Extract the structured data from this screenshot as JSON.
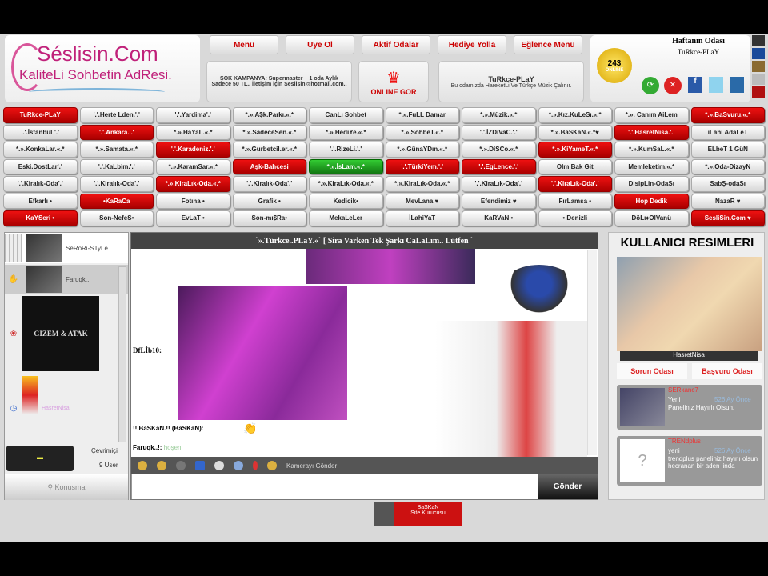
{
  "logo": {
    "title": "Séslisin.Com",
    "subtitle": "KaliteLi Sohbetin AdResi."
  },
  "nav": [
    "Menü",
    "Uye Ol",
    "Aktif Odalar",
    "Hediye Yolla",
    "Eğlence Menü"
  ],
  "promo": "ŞOK KAMPANYA: Supermaster + 1 oda Aylık Sadece 50 TL.. İletişim için Seslisin@hotmail.com..",
  "online_label": "ONLINE GOR",
  "room_info": {
    "name": "TuRkce-PLaY",
    "desc": "Bu odamızda HareketLi Ve Türkçe Müzik Çalınır."
  },
  "week_room": {
    "title": "Haftanın Odası",
    "name": "TuRkce-PLaY",
    "badge": "243",
    "badge_sub": "ONLINE"
  },
  "theme_colors": [
    "#333333",
    "#1a4a9a",
    "#8a6a30",
    "#bbbbbb",
    "#b01010"
  ],
  "grid": [
    [
      [
        "TuRkce-PLaY",
        "red"
      ],
      [
        "'.'.Herte Lden.'.'",
        ""
      ],
      [
        "'.'.Yardima'.'",
        ""
      ],
      [
        "*.».A$k.Parkı.«.*",
        ""
      ],
      [
        "CanLı Sohbet",
        ""
      ],
      [
        "*.».FuLL Damar",
        ""
      ],
      [
        "*.».Müzik.«.*",
        ""
      ],
      [
        "*.».Kız.KuLeSı.«.*",
        ""
      ],
      [
        "*.». Canım AiLem",
        ""
      ],
      [
        "*.».BaSvuru.«.*",
        "red"
      ]
    ],
    [
      [
        "'.'.İstanbuL'.'",
        ""
      ],
      [
        "'.'.Ankara.'.'",
        "red"
      ],
      [
        "*.».HaYaL.«.*",
        ""
      ],
      [
        "*.».SadeceSen.«.*",
        ""
      ],
      [
        "*.».HediYe.«.*",
        ""
      ],
      [
        "*.».SohbeT.«.*",
        ""
      ],
      [
        "'.'.İZDiVaC.'.'",
        ""
      ],
      [
        "*.».BaSKaN.«.*♥",
        ""
      ],
      [
        "'.'.HasretNisa.'.'",
        "red"
      ],
      [
        "iLahi AdaLeT",
        ""
      ]
    ],
    [
      [
        "*.».KonkaLar.«.*",
        ""
      ],
      [
        "*.».Samata.«.*",
        ""
      ],
      [
        "'.'.Karadeniz.'.'",
        "red"
      ],
      [
        "*.».Gurbetcil.er.«.*",
        ""
      ],
      [
        "'.'.RizeLi.'.'",
        ""
      ],
      [
        "*.».GünaYDın.«.*",
        ""
      ],
      [
        "*.».DiSCo.«.*",
        ""
      ],
      [
        "*.».KiYameT.«.*",
        "red"
      ],
      [
        "*.».KumSaL.«.*",
        ""
      ],
      [
        "ELbeT 1 GüN",
        ""
      ]
    ],
    [
      [
        "Eski.DostLar'.'",
        ""
      ],
      [
        "'.'.KaLbim.'.'",
        ""
      ],
      [
        "*.».KaramSar.«.*",
        ""
      ],
      [
        "Aşk-Bahcesi",
        "red"
      ],
      [
        "*.».İsLam.«.*",
        "green"
      ],
      [
        "'.'.TürkiYem.'.'",
        "red"
      ],
      [
        "'.'.EgLence.'.'",
        "red"
      ],
      [
        "Olm Bak Git",
        ""
      ],
      [
        "Memleketim.«.*",
        ""
      ],
      [
        "*.».Oda-DizayN",
        ""
      ]
    ],
    [
      [
        "'.'.Kiralık-Oda'.'",
        ""
      ],
      [
        "'.'.Kiralık-Oda'.'",
        ""
      ],
      [
        "*.».KiraLık-Oda.«.*",
        "red"
      ],
      [
        "'.'.Kiralık-Oda'.'",
        ""
      ],
      [
        "*.».KiraLık-Oda.«.*",
        ""
      ],
      [
        "*.».KiraLık-Oda.«.*",
        ""
      ],
      [
        "'.'.KiraLık-Oda'.'",
        ""
      ],
      [
        "'.'.KiraLık-Oda'.'",
        "red"
      ],
      [
        "DisipLin-OdaSı",
        ""
      ],
      [
        "SabŞ-odaSı",
        ""
      ]
    ],
    [
      [
        "Efkarlı •",
        ""
      ],
      [
        "•KaRaCa",
        "red"
      ],
      [
        "Fotına •",
        ""
      ],
      [
        "Grafik •",
        ""
      ],
      [
        "Kedicik•",
        ""
      ],
      [
        "MevLana ♥",
        ""
      ],
      [
        "Efendimiz ♥",
        ""
      ],
      [
        "FırLamsa •",
        ""
      ],
      [
        "Hop Dedik",
        "red"
      ],
      [
        "NazaR ♥",
        ""
      ]
    ],
    [
      [
        "KaYSeri •",
        "red"
      ],
      [
        "Son-NefeS•",
        ""
      ],
      [
        "EvLaT •",
        ""
      ],
      [
        "Son-mı$Ra•",
        ""
      ],
      [
        "MekaLeLer",
        ""
      ],
      [
        "İLahiYaT",
        ""
      ],
      [
        "KaRVaN •",
        ""
      ],
      [
        "• Denizli",
        ""
      ],
      [
        "DöLı♦OlVanü",
        ""
      ],
      [
        "SesliSin.Com ♥",
        "red"
      ]
    ]
  ],
  "users": [
    {
      "name": "SeRoRi-STyLe"
    },
    {
      "name": "Faruqk..!"
    },
    {
      "name": "GIZEM & ATAK"
    },
    {
      "name": "HasretNisa"
    }
  ],
  "user_footer": {
    "link": "Çevrimiçi",
    "count": "9 User",
    "tab": "Konusma"
  },
  "chat": {
    "title": "`».Türkce..PLaY.«` [ Sira Varken Tek Şarkı CaLaLım.. Lütfen `",
    "messages": [
      {
        "nick": "DfLİb10:",
        "text": ""
      },
      {
        "nick": "!!.BaSKaN.!! (BaSKaN):",
        "text": ""
      },
      {
        "nick": "Faruqk..!:",
        "text": "hoşen"
      }
    ],
    "camera_label": "Kamerayı Gönder",
    "input_placeholder": "",
    "send": "Gönder"
  },
  "banner": {
    "line1": "BaSKaN",
    "line2": "Site Kurucusu"
  },
  "right": {
    "title": "KULLANICI RESIMLERI",
    "photo_name": "HasretNisa",
    "buttons": [
      "Sorun Odası",
      "Başvuru Odası"
    ],
    "posts": [
      {
        "user": "SERkanc7",
        "type": "Yeni",
        "time": "526 Ay Önce",
        "text": "Paneliniz Hayırlı Olsun."
      },
      {
        "user": "TRENdplus",
        "type": "yeni",
        "time": "526 Ay Önce",
        "text": "trendplus paneliniz hayırlı olsun hecranan bir aden linda"
      }
    ]
  }
}
